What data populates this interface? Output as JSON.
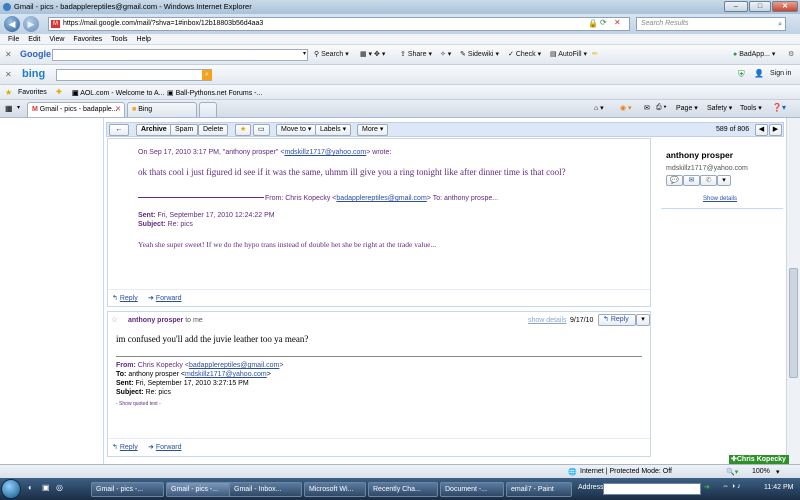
{
  "window": {
    "title": "Gmail - pics - badapplereptiles@gmail.com - Windows Internet Explorer",
    "min": "–",
    "max": "□",
    "close": "✕"
  },
  "address": {
    "url": "https://mail.google.com/mail/?shva=1#inbox/12b18803b56d4aa3",
    "search_placeholder": "Search Results"
  },
  "menu": [
    "File",
    "Edit",
    "View",
    "Favorites",
    "Tools",
    "Help"
  ],
  "google_toolbar": {
    "logo": "Google",
    "search_btn": "Search",
    "items": [
      "Share",
      "Sidewiki",
      "Check",
      "AutoFill"
    ],
    "account": "BadApp...",
    "signin": "Sign In"
  },
  "bing_toolbar": {
    "logo": "bing",
    "signin": "Sign in"
  },
  "favorites": {
    "label": "Favorites",
    "items": [
      "AOL.com - Welcome to A...",
      "Ball-Pythons.net Forums -..."
    ]
  },
  "tabs": {
    "items": [
      "Gmail - pics - badapple...",
      "Bing"
    ],
    "right_items": [
      "Page",
      "Safety",
      "Tools"
    ]
  },
  "gmail": {
    "actions": {
      "back": "←",
      "archive": "Archive",
      "spam": "Spam",
      "delete": "Delete",
      "move_to": "Move to ▾",
      "labels": "Labels ▾",
      "more": "More ▾",
      "counter": "589 of 806",
      "prev": "◀",
      "next": "▶"
    },
    "message1": {
      "quote_header_pre": "On Sep 17, 2010 3:17 PM, \"anthony prosper\" <",
      "quote_header_email": "mdskillz1717@yahoo.com",
      "quote_header_post": "> wrote:",
      "quote_body": "ok thats cool i just figured id see if it was the same, uhmm ill give you a ring tonight like after dinner time is that cool?",
      "from_label": "From:",
      "from_name": "Chris Kopecky <",
      "from_email": "badapplereptiles@gmail.com",
      "to_part": "> To: anthony prospe...",
      "sent_label": "Sent:",
      "sent_value": "Fri, September 17, 2010 12:24:22 PM",
      "subject_label": "Subject:",
      "subject_value": "Re: pics",
      "body": "Yeah she super sweet! If we do the hypo trans instead of double het she be right at the trade value...",
      "reply": "Reply",
      "forward": "Forward"
    },
    "message2": {
      "sender": "anthony prosper",
      "to_me": "to me",
      "show_details": "show details",
      "date": "9/17/10",
      "reply_btn": "Reply",
      "body": "im confused you'll add the juvie leather too ya mean?",
      "from_label": "From:",
      "from_value": "Chris Kopecky <",
      "from_email": "badapplereptiles@gmail.com",
      "to_label": "To:",
      "to_value": "anthony prosper <",
      "to_email": "mdskillz1717@yahoo.com",
      "sent_label": "Sent:",
      "sent_value": "Fri, September 17, 2010 3:27:15 PM",
      "subject_label": "Subject:",
      "subject_value": "Re: pics",
      "show_quoted": "- Show quoted text -",
      "reply": "Reply",
      "forward": "Forward"
    },
    "contact": {
      "name": "anthony prosper",
      "email": "mdskillz1717@yahoo.com",
      "show_details": "Show details"
    },
    "chat": "Chris Kopecky"
  },
  "status": {
    "zone": "Internet | Protected Mode: Off",
    "zoom": "100%"
  },
  "taskbar": {
    "tasks": [
      "Gmail - pics -...",
      "Gmail - pics -...",
      "Gmail - Inbox...",
      "Microsoft Wi...",
      "Recently Cha...",
      "Document -...",
      "email7 - Paint"
    ],
    "address_label": "Address",
    "clock": "11:42 PM"
  }
}
